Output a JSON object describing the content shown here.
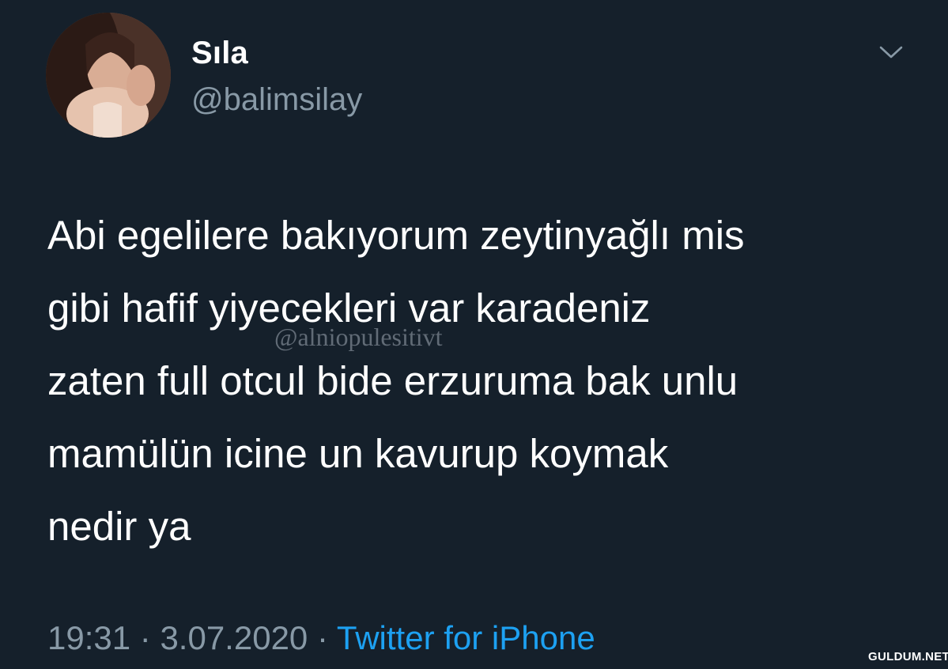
{
  "user": {
    "display_name": "Sıla",
    "handle": "@balimsilay"
  },
  "tweet": {
    "lines": [
      "Abi egelilere bakıyorum zeytinyağlı mis",
      "gibi hafif yiyecekleri var karadeniz",
      "zaten full otcul bide erzuruma bak unlu",
      "mamülün icine un kavurup koymak",
      "nedir ya"
    ]
  },
  "meta": {
    "time": "19:31",
    "separator": " · ",
    "date": "3.07.2020",
    "source": "Twitter for iPhone"
  },
  "overlay": {
    "watermark": "@alniopulesitivt",
    "site_badge": "GULDUM.NET"
  },
  "colors": {
    "background": "#15202b",
    "text": "#ffffff",
    "secondary": "#8899a6",
    "link": "#1da1f2"
  },
  "icons": {
    "more": "chevron-down-icon"
  }
}
